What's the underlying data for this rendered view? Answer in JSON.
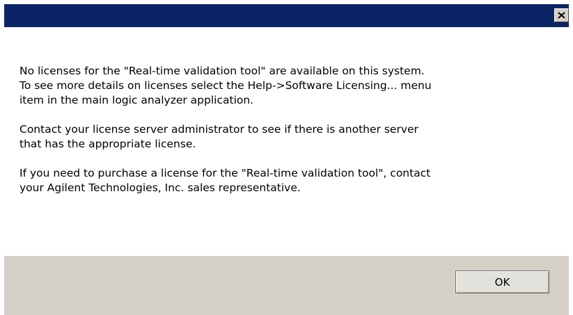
{
  "window": {
    "title": "",
    "close_icon": "close-icon",
    "colors": {
      "titlebar": "#0b2466",
      "footer": "#d4d0c8"
    }
  },
  "message": {
    "paragraphs": [
      "No licenses for the \"Real-time validation tool\" are available on this system.\nTo see more details on licenses select the Help->Software Licensing... menu\nitem in the main logic analyzer application.",
      "Contact your license server administrator to see if there is another server\nthat has the appropriate license.",
      "If you need to purchase a license for the \"Real-time validation tool\", contact\nyour Agilent Technologies, Inc. sales representative."
    ]
  },
  "buttons": {
    "ok_label": "OK"
  }
}
